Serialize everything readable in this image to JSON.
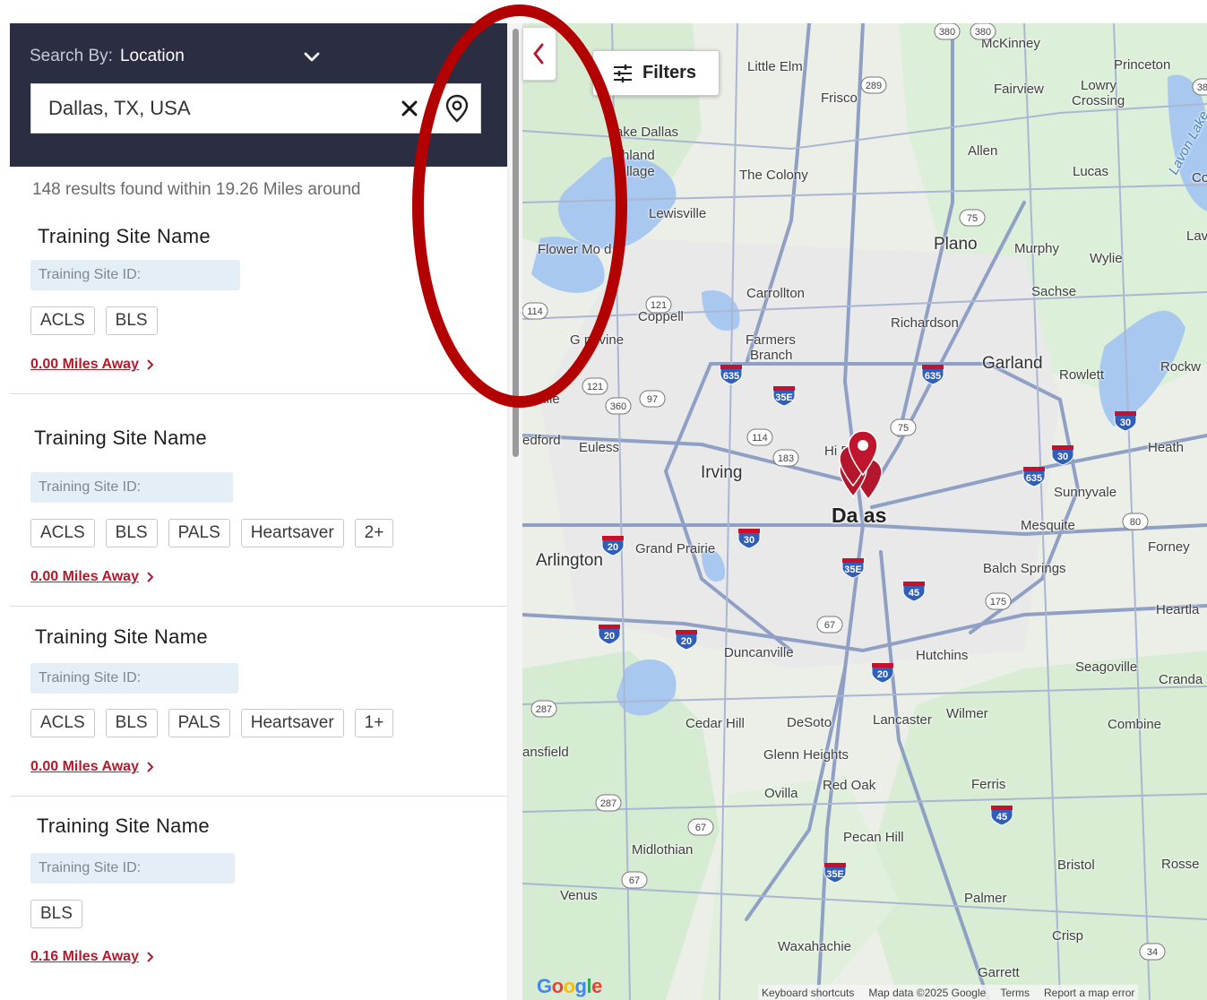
{
  "search": {
    "by_prefix": "Search By:",
    "by_value": "Location",
    "input_value": "Dallas, TX, USA",
    "input_placeholder": ""
  },
  "results": {
    "summary": "148 results found within 19.26 Miles around",
    "items": [
      {
        "name": "Training Site Name",
        "id_label": "Training Site ID:",
        "tags": [
          "ACLS",
          "BLS"
        ],
        "distance": "0.00 Miles Away"
      },
      {
        "name": "Training Site Name",
        "id_label": "Training Site ID:",
        "tags": [
          "ACLS",
          "BLS",
          "PALS",
          "Heartsaver",
          "2+"
        ],
        "distance": "0.00 Miles Away"
      },
      {
        "name": "Training Site Name",
        "id_label": "Training Site ID:",
        "tags": [
          "ACLS",
          "BLS",
          "PALS",
          "Heartsaver",
          "1+"
        ],
        "distance": "0.00 Miles Away"
      },
      {
        "name": "Training Site Name",
        "id_label": "Training Site ID:",
        "tags": [
          "BLS"
        ],
        "distance": "0.16 Miles Away"
      }
    ]
  },
  "map": {
    "filters_label": "Filters",
    "google_logo": "Google",
    "footer": {
      "shortcuts": "Keyboard shortcuts",
      "map_data": "Map data ©2025 Google",
      "terms": "Terms",
      "report": "Report a map error"
    },
    "places": {
      "mckinney": "McKinney",
      "little_elm": "Little Elm",
      "princeton": "Princeton",
      "frisco": "Frisco",
      "fairview": "Fairview",
      "lowry": "Lowry",
      "crossing": "Crossing",
      "lake_dallas": "ake Dallas",
      "highland": "hland",
      "village": "llage",
      "the_colony": "The Colony",
      "allen": "Allen",
      "lucas": "Lucas",
      "lewisville": "Lewisville",
      "flower_mound": "Flower Mo     d",
      "plano": "Plano",
      "murphy": "Murphy",
      "wylie": "Wylie",
      "carrollton": "Carrollton",
      "sachse": "Sachse",
      "coppell": "Coppell",
      "richardson": "Richardson",
      "grapevine": "G     pevine",
      "farmers": "Farmers",
      "branch": "Branch",
      "garland": "Garland",
      "rowlett": "Rowlett",
      "rockwall": "Rockw",
      "colleyville": "eyville",
      "bedford": "edford",
      "euless": "Euless",
      "highland_park": "Hi        Park",
      "irving": "Irving",
      "heath": "Heath",
      "sunnyvale": "Sunnyvale",
      "dallas": "Da    as",
      "mesquite": "Mesquite",
      "forney": "Forney",
      "grand_prairie": "Grand Prairie",
      "arlington": "Arlington",
      "balch": "Balch Springs",
      "heartland": "Heartla",
      "duncanville": "Duncanville",
      "hutchins": "Hutchins",
      "seagoville": "Seagoville",
      "crandall": "Cranda",
      "cedar_hill": "Cedar Hill",
      "desoto": "DeSoto",
      "lancaster": "Lancaster",
      "wilmer": "Wilmer",
      "combine": "Combine",
      "mansfield": "ansfield",
      "glenn": "Glenn Heights",
      "ovilla": "Ovilla",
      "red_oak": "Red Oak",
      "ferris": "Ferris",
      "pecan_hill": "Pecan Hill",
      "midlothian": "Midlothian",
      "bristol": "Bristol",
      "rosser": "Rosse",
      "venus": "Venus",
      "palmer": "Palmer",
      "crisp": "Crisp",
      "waxahachie": "Waxahachie",
      "garrett": "Garrett",
      "lavon_lake": "Lavon Lake",
      "lav": "Lav",
      "co": "Co"
    },
    "shields": [
      "289",
      "121",
      "635",
      "635",
      "35E",
      "114",
      "183",
      "360",
      "97",
      "75",
      "121",
      "30",
      "635",
      "80",
      "30",
      "30",
      "20",
      "20",
      "20",
      "35E",
      "45",
      "175",
      "67",
      "20",
      "287",
      "287",
      "67",
      "67",
      "35E",
      "45",
      "34",
      "75",
      "114",
      "380",
      "380",
      "380"
    ]
  },
  "colors": {
    "header_bg": "#2b2d42",
    "accent_red": "#b01c2e",
    "badge_bg": "#e3eef6",
    "annotation": "#b30000"
  }
}
